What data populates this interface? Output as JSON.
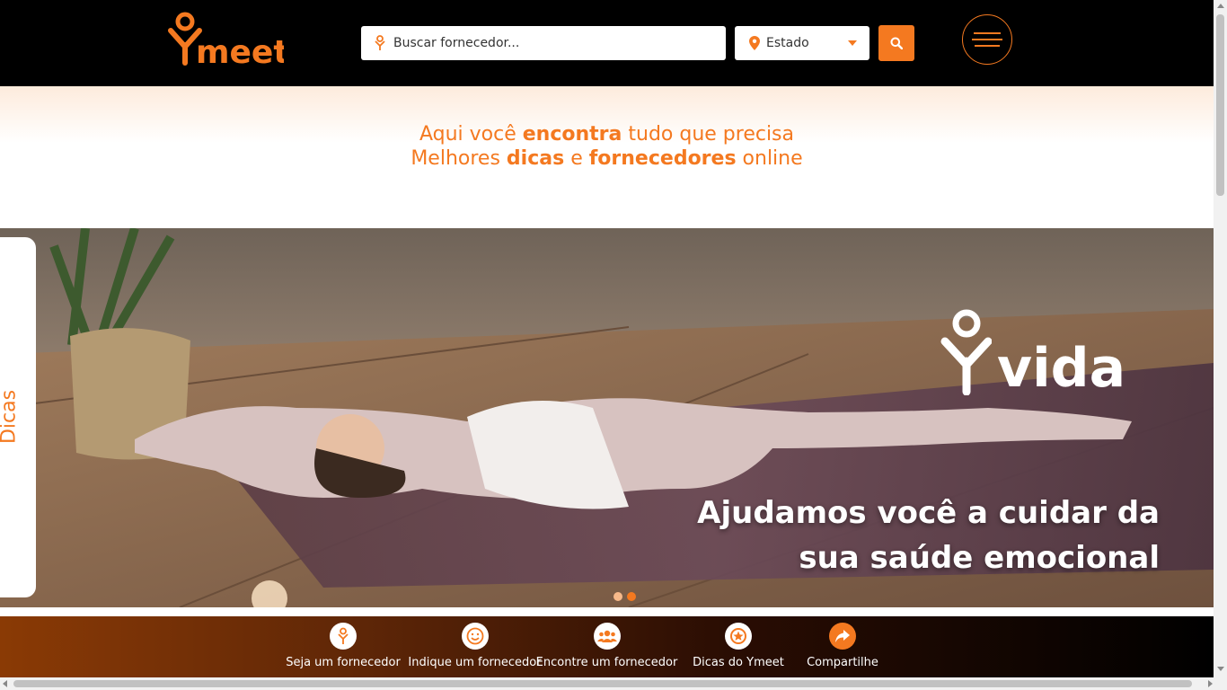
{
  "header": {
    "logo_text": "meet",
    "search": {
      "placeholder": "Buscar fornecedor..."
    },
    "state_select": {
      "selected": "Estado"
    }
  },
  "tagline": {
    "line1": {
      "pre": "Aqui você ",
      "bold": "encontra",
      "post": " tudo que precisa"
    },
    "line2": {
      "pre": "Melhores ",
      "bold1": "dicas",
      "mid": " e ",
      "bold2": "fornecedores",
      "post": " online"
    }
  },
  "side_tab": {
    "label": "Dicas"
  },
  "banner": {
    "brand": "vida",
    "headline_line1": "Ajudamos você a cuidar da",
    "headline_line2": "sua saúde emocional",
    "slides_total": 2,
    "active_slide": 2
  },
  "footer": {
    "items": [
      {
        "label": "Seja um fornecedor",
        "icon": "person-pin-icon"
      },
      {
        "label": "Indique um fornecedor",
        "icon": "smiley-icon"
      },
      {
        "label": "Encontre um fornecedor",
        "icon": "users-icon"
      },
      {
        "label": "Dicas do Ymeet",
        "icon": "star-badge-icon"
      },
      {
        "label": "Compartilhe",
        "icon": "share-icon"
      }
    ]
  },
  "colors": {
    "accent": "#f47920",
    "header_bg": "#000000"
  }
}
